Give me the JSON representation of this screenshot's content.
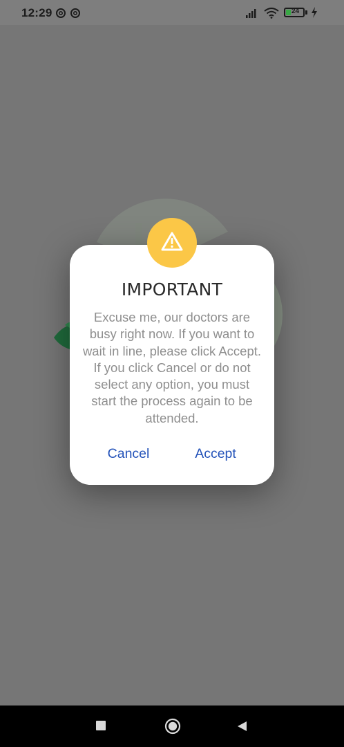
{
  "status_bar": {
    "time": "12:29",
    "notification_icons": [
      "at-sign-icon",
      "at-sign-icon"
    ],
    "battery_level": "24",
    "system_icons": [
      "signal-icon",
      "wifi-icon",
      "battery-icon",
      "charging-icon"
    ]
  },
  "dialog": {
    "icon": "warning-icon",
    "title": "IMPORTANT",
    "message": "Excuse me, our doctors are busy right now. If you want to wait in line, please click Accept. If you click Cancel or do not select any option, you must start the process again to be attended.",
    "cancel_label": "Cancel",
    "accept_label": "Accept"
  },
  "colors": {
    "overlay": "#767676",
    "badge": "#fbc747",
    "button_text": "#2352b9",
    "message_text": "#8e8e8e"
  },
  "nav_bar": {
    "buttons": [
      "recents-square-icon",
      "home-circle-icon",
      "back-triangle-icon"
    ]
  }
}
